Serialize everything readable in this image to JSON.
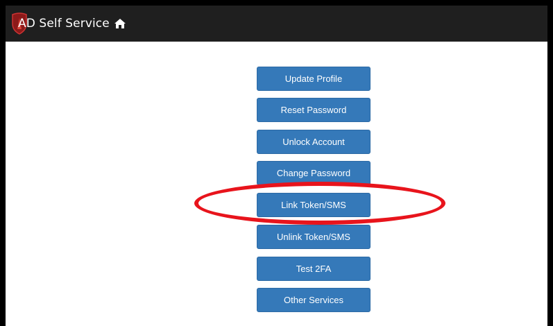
{
  "header": {
    "brand_title": "AD Self Service",
    "background_color": "#1f1f1f"
  },
  "icons": {
    "logo": "shield-logo-icon",
    "home": "home-icon"
  },
  "menu": {
    "buttons": [
      {
        "label": "Update Profile"
      },
      {
        "label": "Reset Password"
      },
      {
        "label": "Unlock Account"
      },
      {
        "label": "Change Password"
      },
      {
        "label": "Link Token/SMS"
      },
      {
        "label": "Unlink Token/SMS"
      },
      {
        "label": "Test 2FA"
      },
      {
        "label": "Other Services"
      }
    ],
    "button_color": "#3579b9"
  },
  "annotation": {
    "highlighted_item": "Link Token/SMS",
    "highlight_color": "#e8141c"
  }
}
